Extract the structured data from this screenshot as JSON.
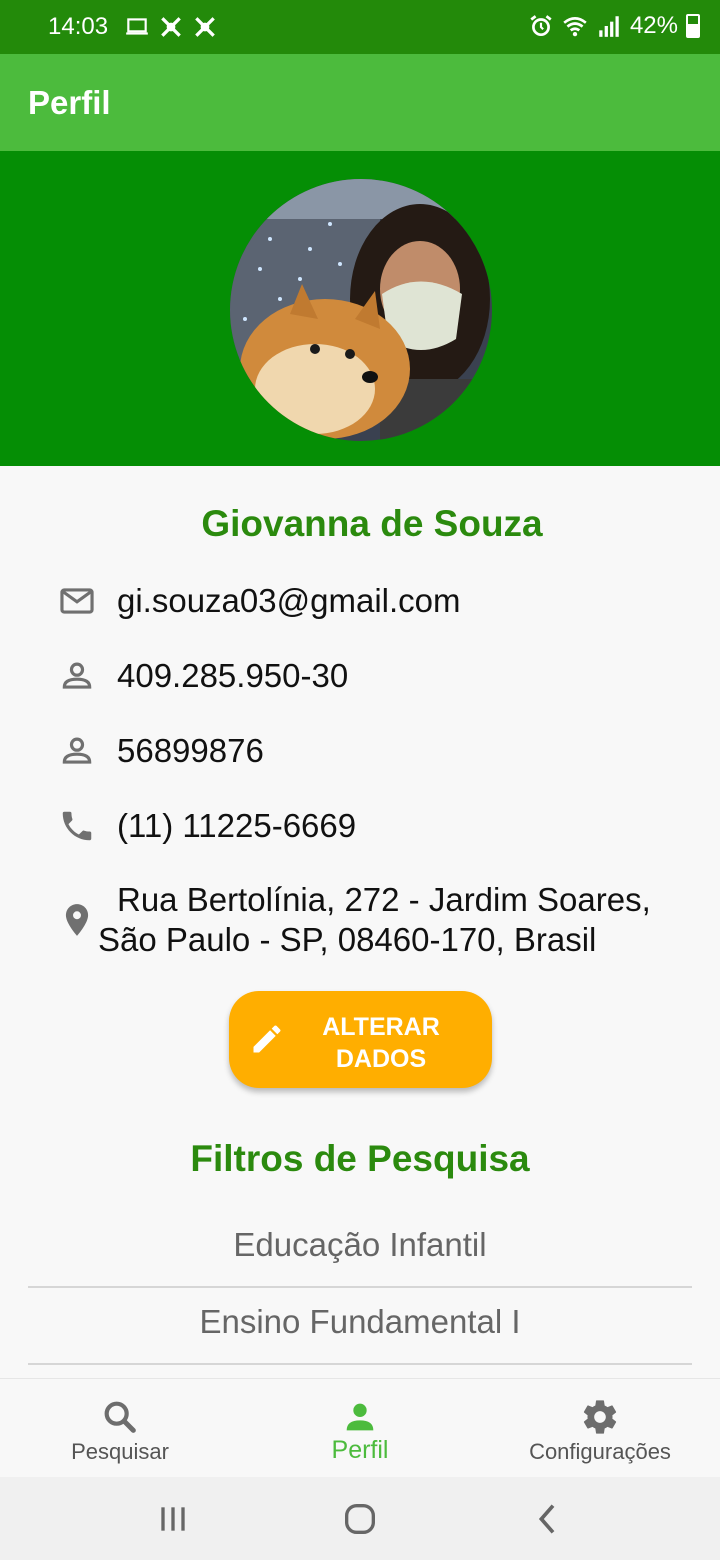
{
  "status_bar": {
    "time": "14:03",
    "battery": "42%",
    "left_icons": [
      "laptop-icon",
      "app-icon",
      "app-icon"
    ],
    "right_icons": [
      "alarm-icon",
      "wifi-icon",
      "signal-icon",
      "battery-icon"
    ]
  },
  "app_bar": {
    "title": "Perfil"
  },
  "profile": {
    "name": "Giovanna de Souza",
    "email": "gi.souza03@gmail.com",
    "cpf": "409.285.950-30",
    "id_number": "56899876",
    "phone": "(11) 11225-6669",
    "address_line1": "Rua Bertolínia, 272 - Jardim Soares,",
    "address_line2": "São Paulo - SP, 08460-170, Brasil"
  },
  "edit_button": {
    "label": "ALTERAR DADOS"
  },
  "filters": {
    "title": "Filtros de Pesquisa",
    "items": [
      "Educação Infantil",
      "Ensino Fundamental I"
    ]
  },
  "bottom_nav": {
    "items": [
      {
        "label": "Pesquisar",
        "icon": "search-icon"
      },
      {
        "label": "Perfil",
        "icon": "person-icon",
        "active": true
      },
      {
        "label": "Configurações",
        "icon": "gear-icon"
      }
    ]
  },
  "colors": {
    "status_bar": "#238a0a",
    "app_bar": "#4cbb3d",
    "header": "#058e05",
    "accent_green": "#2b8a0e",
    "button": "#ffae00"
  }
}
